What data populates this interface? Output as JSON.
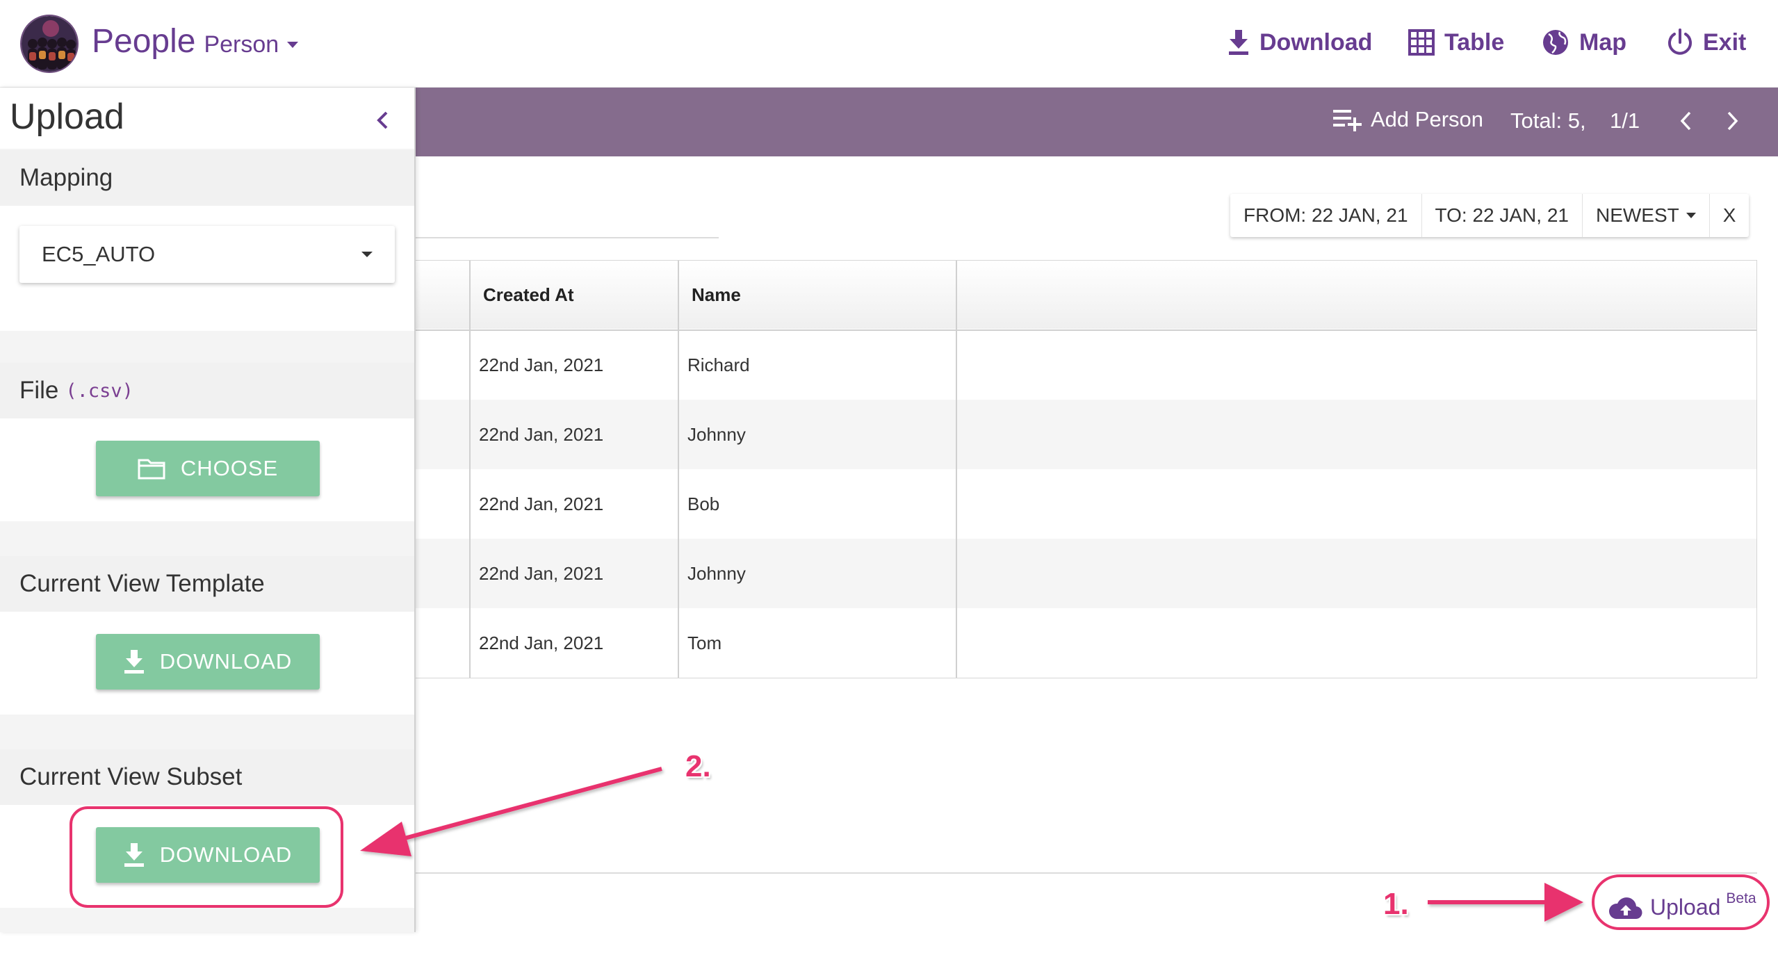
{
  "app": {
    "title": "People",
    "subtitle": "Person"
  },
  "nav": {
    "download": "Download",
    "table": "Table",
    "map": "Map",
    "exit": "Exit"
  },
  "toolbar": {
    "add_label": "Add Person",
    "total": "Total: 5,",
    "page": "1/1"
  },
  "filters": {
    "from": "FROM: 22 JAN, 21",
    "to": "TO: 22 JAN, 21",
    "sort": "NEWEST",
    "clear": "X"
  },
  "table": {
    "headers": [
      "",
      "Created At",
      "Name",
      ""
    ],
    "rows": [
      {
        "created_at": "22nd Jan, 2021",
        "name": "Richard"
      },
      {
        "created_at": "22nd Jan, 2021",
        "name": "Johnny"
      },
      {
        "created_at": "22nd Jan, 2021",
        "name": "Bob"
      },
      {
        "created_at": "22nd Jan, 2021",
        "name": "Johnny"
      },
      {
        "created_at": "22nd Jan, 2021",
        "name": "Tom"
      }
    ]
  },
  "panel": {
    "title": "Upload",
    "mapping_label": "Mapping",
    "mapping_value": "EC5_AUTO",
    "file_label": "File",
    "file_hint": "(.csv)",
    "choose_label": "CHOOSE",
    "template_label": "Current View Template",
    "template_button": "DOWNLOAD",
    "subset_label": "Current View Subset",
    "subset_button": "DOWNLOAD"
  },
  "upload_beta": {
    "label": "Upload",
    "badge": "Beta"
  },
  "annotations": {
    "step1": "1.",
    "step2": "2."
  },
  "colors": {
    "brand": "#673c90",
    "toolbar": "#856c8d",
    "button_green": "#83c9a0",
    "annotation": "#e8336e"
  }
}
